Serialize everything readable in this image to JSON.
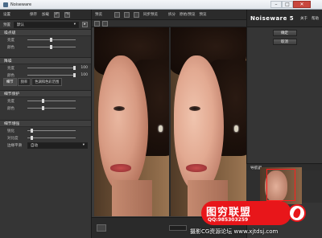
{
  "window": {
    "title": "Noiseware",
    "minimize": "–",
    "maximize": "□",
    "close": "✕"
  },
  "left": {
    "toolbar": {
      "settings": "设置",
      "save": "保存",
      "load": "加载"
    },
    "preset": {
      "label": "预置",
      "value": "默认"
    },
    "noise_level": {
      "title": "噪点级",
      "sliders": [
        {
          "label": "亮度",
          "value": ""
        },
        {
          "label": "颜色",
          "value": ""
        }
      ]
    },
    "noise_reduction": {
      "title": "降噪",
      "sliders": [
        {
          "label": "亮度",
          "value": "100"
        },
        {
          "label": "颜色",
          "value": "100"
        }
      ]
    },
    "tabs": [
      "细节",
      "频率",
      "色调和色彩范围"
    ],
    "detail_protect": {
      "title": "细节保护",
      "sliders": [
        {
          "label": "亮度",
          "value": ""
        },
        {
          "label": "颜色",
          "value": ""
        }
      ]
    },
    "detail_enhance": {
      "title": "细节增强",
      "sliders": [
        {
          "label": "锐化",
          "value": ""
        },
        {
          "label": "对比度",
          "value": ""
        }
      ],
      "select_label": "边缘平滑",
      "select_value": "自动"
    }
  },
  "center": {
    "title": "预览",
    "options": {
      "before_after": "原始/预览",
      "split": "拆分",
      "compare": "同步预览",
      "crop": "预览"
    }
  },
  "right": {
    "brand": "Noiseware 5",
    "links": {
      "about": "关于",
      "help": "帮助"
    },
    "ok": "确定",
    "cancel": "取消",
    "navigator": "导航器"
  },
  "watermark": {
    "title": "图穷联盟",
    "qq": "QQ:985303259",
    "footer": "摄影CG资源论坛 www.xjtdsj.com"
  }
}
